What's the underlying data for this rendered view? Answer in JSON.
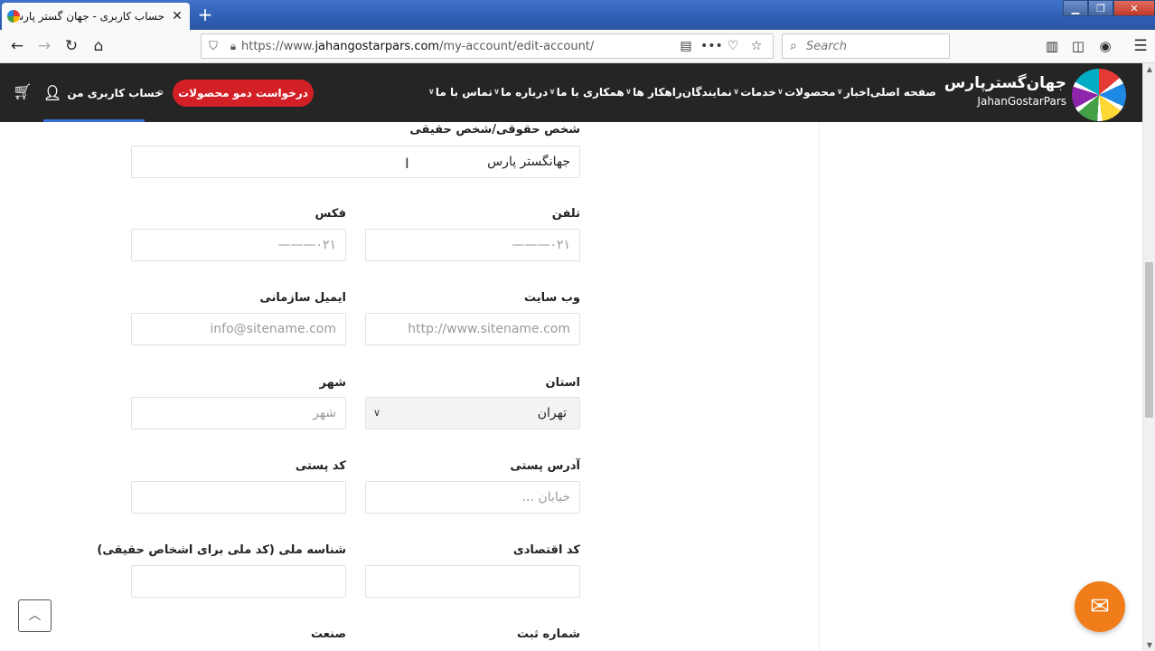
{
  "browser": {
    "tab_title": "حساب کاربری - جهان گستر پارس",
    "url_prefix": "https://www.",
    "url_domain": "jahangostarpars.com",
    "url_path": "/my-account/edit-account/",
    "search_placeholder": "Search"
  },
  "header": {
    "logo_fa": "جهان‌گسترپارس",
    "logo_en": "JahanGostarPars",
    "menu": [
      "صفحه اصلی",
      "اخبار",
      "محصولات",
      "خدمات",
      "نمایندگان",
      "راهکار ها",
      "همکاری با ما",
      "درباره ما",
      "تماس با ما"
    ],
    "demo_button": "درخواست دمو محصولات",
    "account_label": "حساب کاربری من"
  },
  "form": {
    "company_label": "شخص حقوقی/شخص حقیقی",
    "company_value": "جهانگستر پارس",
    "phone_label": "تلفن",
    "phone_placeholder": "۰۲۱———",
    "fax_label": "فکس",
    "fax_placeholder": "۰۲۱———",
    "website_label": "وب سایت",
    "website_placeholder": "http://www.sitename.com",
    "email_label": "ایمیل سازمانی",
    "email_placeholder": "info@sitename.com",
    "province_label": "استان",
    "province_value": "تهران",
    "city_label": "شهر",
    "city_placeholder": "شهر",
    "address_label": "آدرس پستی",
    "address_placeholder": "خیابان ...",
    "postal_label": "کد پستی",
    "economic_label": "کد اقتصادی",
    "national_label": "شناسه ملی (کد ملی برای اشخاص حقیقی)",
    "registration_label": "شماره ثبت",
    "industry_label": "صنعت"
  }
}
